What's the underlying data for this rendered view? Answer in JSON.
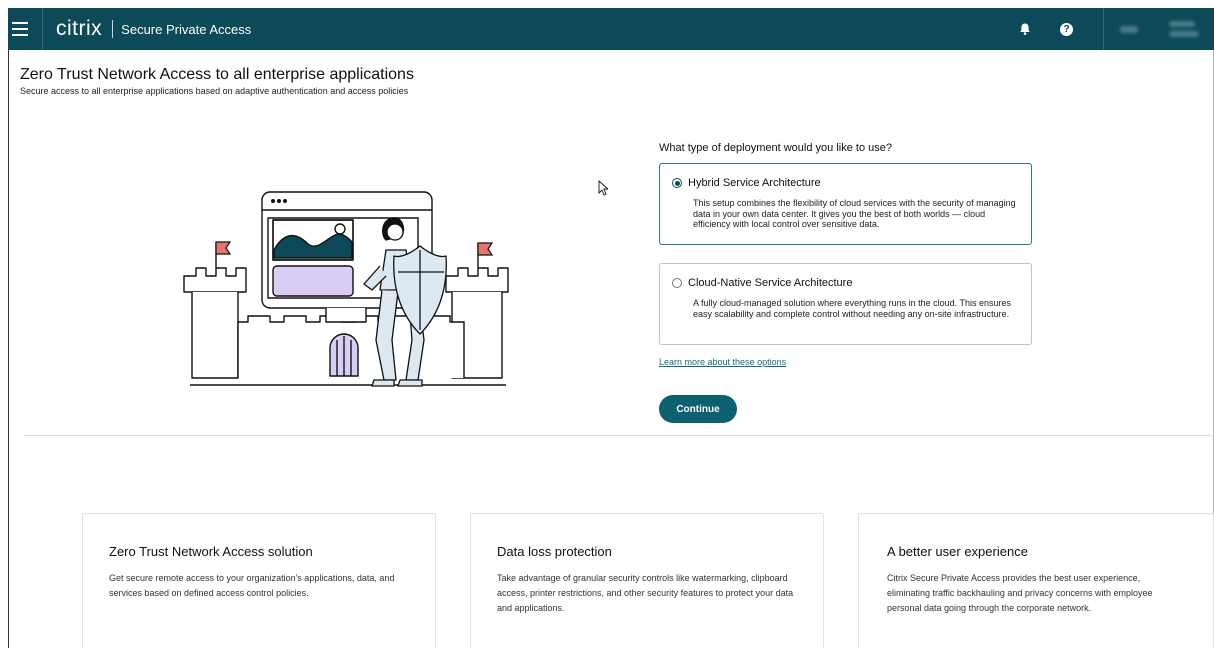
{
  "header": {
    "brand": "citrix",
    "product": "Secure Private Access",
    "icons": [
      "menu-icon",
      "bell-icon",
      "help-icon"
    ],
    "help_glyph": "?"
  },
  "page": {
    "title": "Zero Trust Network Access to all enterprise applications",
    "subtitle": "Secure access to all enterprise applications based on adaptive authentication and access policies"
  },
  "deployment": {
    "question": "What type of deployment would you like to use?",
    "options": [
      {
        "label": "Hybrid Service Architecture",
        "selected": true,
        "description": "This setup combines the flexibility of cloud services with the security of managing data in your own data center. It gives you the best of both worlds — cloud efficiency with local control over sensitive data."
      },
      {
        "label": "Cloud-Native Service Architecture",
        "selected": false,
        "description": "A fully cloud-managed solution where everything runs in the cloud. This ensures easy scalability and complete control without needing any on-site infrastructure."
      }
    ],
    "learn_more": "Learn more about these options",
    "continue_label": "Continue"
  },
  "cards": [
    {
      "title": "Zero Trust Network Access solution",
      "text": "Get secure remote access to your organization's applications, data, and services based on defined access control policies."
    },
    {
      "title": "Data loss protection",
      "text": "Take advantage of granular security controls like watermarking, clipboard access, printer restrictions, and other security features to protect your data and applications."
    },
    {
      "title": "A better user experience",
      "text": "Citrix Secure Private Access provides the best user experience, eliminating traffic backhauling and privacy concerns with employee personal data going through the corporate network."
    }
  ],
  "colors": {
    "header_bg": "#0d4a59",
    "accent": "#0d6070",
    "link": "#0e6e80",
    "flag": "#e8736f",
    "panel_lavender": "#d9ccf5",
    "knight": "#dce8f2"
  }
}
